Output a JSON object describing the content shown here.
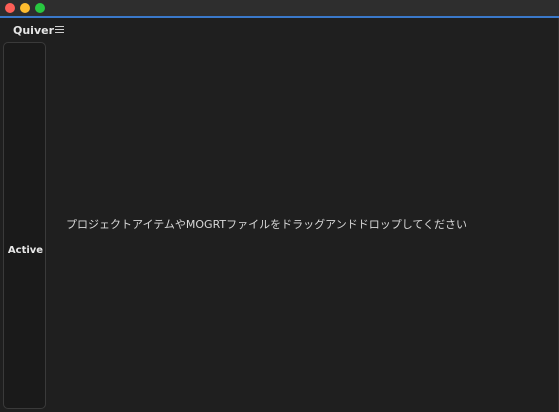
{
  "window": {
    "controls": {
      "close": "#fe5f57",
      "minimize": "#febc2e",
      "zoom": "#28c840"
    },
    "accent_color": "#3a78c9"
  },
  "panel": {
    "title": "Quiver",
    "menu_icon": "hamburger-menu-icon",
    "side_tab_label": "Active",
    "drop_message": "プロジェクトアイテムやMOGRTファイルをドラッグアンドドロップしてください"
  }
}
